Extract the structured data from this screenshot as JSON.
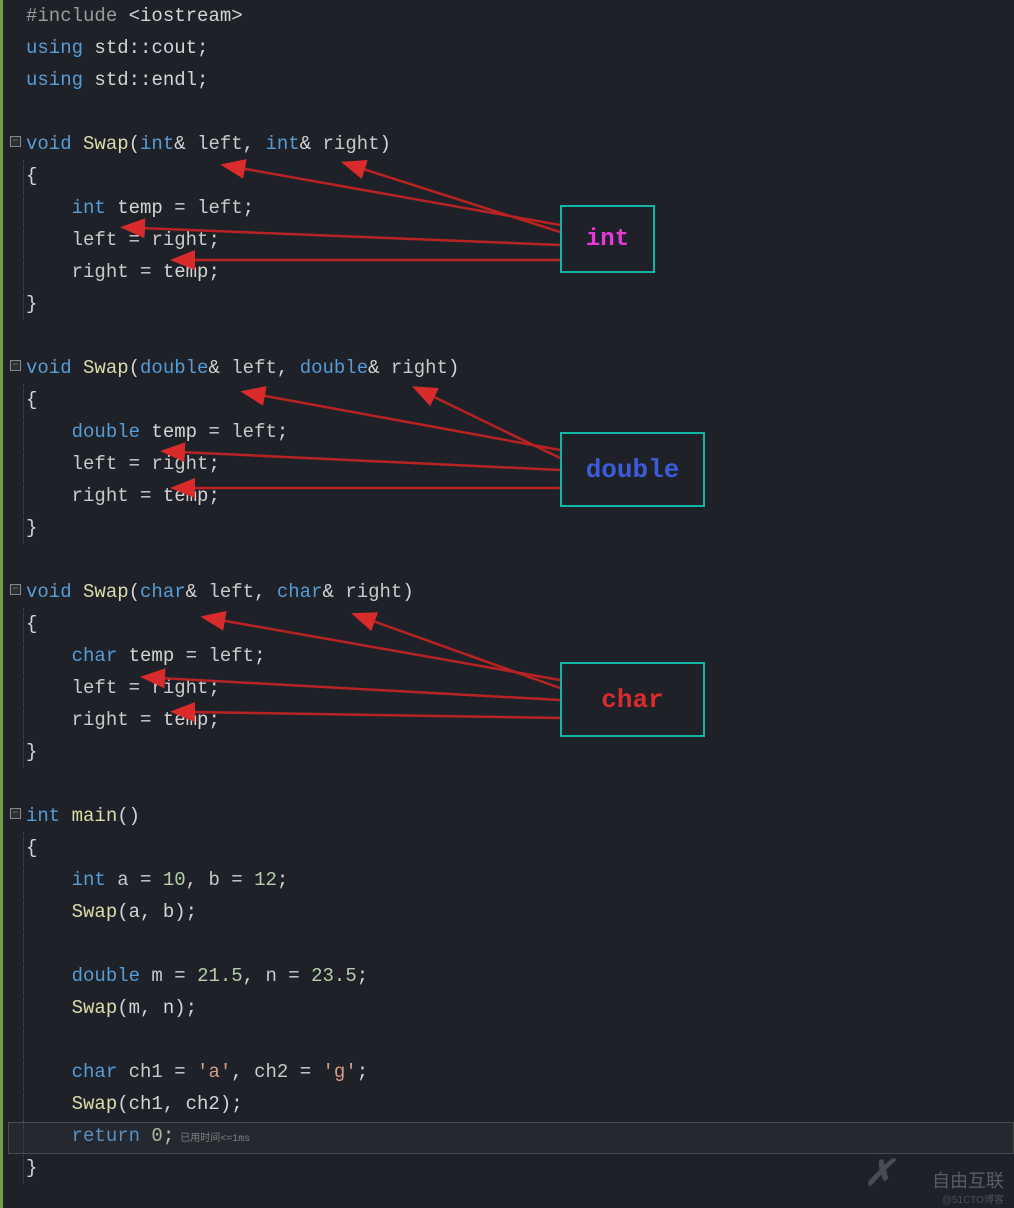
{
  "code": {
    "l1": {
      "inc": "#include",
      "open": " <",
      "lib": "iostream",
      "close": ">"
    },
    "l2": {
      "using": "using",
      "std": " std",
      "scope": "::",
      "name": "cout",
      "semi": ";"
    },
    "l3": {
      "using": "using",
      "std": " std",
      "scope": "::",
      "name": "endl",
      "semi": ";"
    },
    "swap_int": {
      "ret": "void",
      "name": " Swap",
      "op": "(",
      "t1": "int",
      "amp1": "& ",
      "p1": "left",
      "comma": ", ",
      "t2": "int",
      "amp2": "& ",
      "p2": "right",
      "cp": ")",
      "body1_t": "int",
      "body1_v": " temp",
      "body1_eq": " = ",
      "body1_r": "left",
      "body1_s": ";",
      "body2_l": "left",
      "body2_eq": " = ",
      "body2_r": "right",
      "body2_s": ";",
      "body3_l": "right",
      "body3_eq": " = ",
      "body3_r": "temp",
      "body3_s": ";"
    },
    "swap_double": {
      "ret": "void",
      "name": " Swap",
      "op": "(",
      "t1": "double",
      "amp1": "& ",
      "p1": "left",
      "comma": ", ",
      "t2": "double",
      "amp2": "& ",
      "p2": "right",
      "cp": ")",
      "body1_t": "double",
      "body1_v": " temp",
      "body1_eq": " = ",
      "body1_r": "left",
      "body1_s": ";",
      "body2_l": "left",
      "body2_eq": " = ",
      "body2_r": "right",
      "body2_s": ";",
      "body3_l": "right",
      "body3_eq": " = ",
      "body3_r": "temp",
      "body3_s": ";"
    },
    "swap_char": {
      "ret": "void",
      "name": " Swap",
      "op": "(",
      "t1": "char",
      "amp1": "& ",
      "p1": "left",
      "comma": ", ",
      "t2": "char",
      "amp2": "& ",
      "p2": "right",
      "cp": ")",
      "body1_t": "char",
      "body1_v": " temp",
      "body1_eq": " = ",
      "body1_r": "left",
      "body1_s": ";",
      "body2_l": "left",
      "body2_eq": " = ",
      "body2_r": "right",
      "body2_s": ";",
      "body3_l": "right",
      "body3_eq": " = ",
      "body3_r": "temp",
      "body3_s": ";"
    },
    "main": {
      "ret": "int",
      "name": " main",
      "parens": "()",
      "l1_t": "int",
      "l1_a": " a",
      "l1_eq": " = ",
      "l1_v1": "10",
      "l1_c": ", ",
      "l1_b": "b",
      "l1_eq2": " = ",
      "l1_v2": "12",
      "l1_s": ";",
      "l2_f": "Swap",
      "l2_args": "(a, b)",
      "l2_s": ";",
      "l3_t": "double",
      "l3_m": " m",
      "l3_eq": " = ",
      "l3_v1": "21.5",
      "l3_c": ", ",
      "l3_n": "n",
      "l3_eq2": " = ",
      "l3_v2": "23.5",
      "l3_s": ";",
      "l4_f": "Swap",
      "l4_args": "(m, n)",
      "l4_s": ";",
      "l5_t": "char",
      "l5_a": " ch1",
      "l5_eq": " = ",
      "l5_v1": "'a'",
      "l5_c": ", ",
      "l5_b": "ch2",
      "l5_eq2": " = ",
      "l5_v2": "'g'",
      "l5_s": ";",
      "l6_f": "Swap",
      "l6_args": "(ch1, ch2)",
      "l6_s": ";",
      "ret_kw": "return",
      "ret_v": " 0",
      "ret_s": ";"
    },
    "brace_open": "{",
    "brace_close": "}",
    "timing": " 已用时间<=1ms"
  },
  "annotations": {
    "int_label": "int",
    "double_label": "double",
    "char_label": "char"
  },
  "watermark": {
    "main": "自由互联",
    "sub": "@51CTO博客"
  }
}
